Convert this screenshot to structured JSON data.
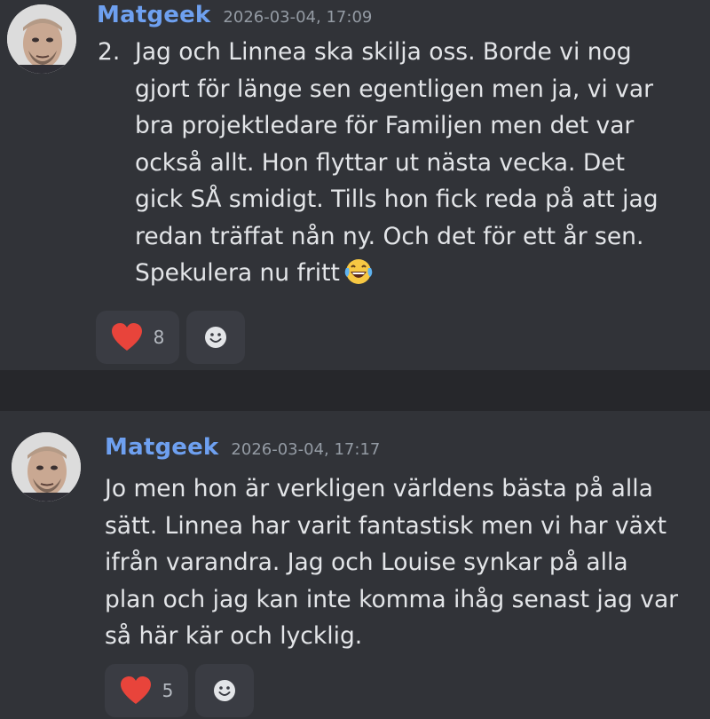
{
  "messages": [
    {
      "username": "Matgeek",
      "timestamp": "2026-03-04, 17:09",
      "list_number": "2.",
      "lines": [
        "Jag och Linnea ska skilja oss. Borde vi nog",
        "gjort för länge sen egentligen men ja, vi var",
        "bra projektledare för Familjen men det var",
        "också allt. Hon flyttar ut nästa vecka. Det",
        "gick SÅ smidigt. Tills hon fick reda på att jag",
        "redan träffat nån ny. Och det för ett år sen.",
        "Spekulera nu fritt"
      ],
      "inline_emoji": "laughing-tears-emoji",
      "reaction": {
        "emoji": "heart-emoji",
        "count": "8"
      }
    },
    {
      "username": "Matgeek",
      "timestamp": "2026-03-04, 17:17",
      "lines": [
        "Jo men hon är verkligen världens bästa på alla",
        "sätt. Linnea har varit fantastisk men vi har växt",
        "ifrån varandra. Jag och Louise synkar på alla",
        "plan och jag kan inte komma ihåg senast jag var",
        "så här kär och lycklig."
      ],
      "reaction": {
        "emoji": "heart-emoji",
        "count": "5"
      }
    }
  ],
  "colors": {
    "background": "#313338",
    "divider": "#26272b",
    "username": "#6ea0f0",
    "timestamp": "#949ba4",
    "text": "#e3e5e8",
    "reaction_bg": "#3a3c43",
    "heart": "#e8443b"
  },
  "icons": {
    "add_reaction": "smiley-face-icon"
  }
}
